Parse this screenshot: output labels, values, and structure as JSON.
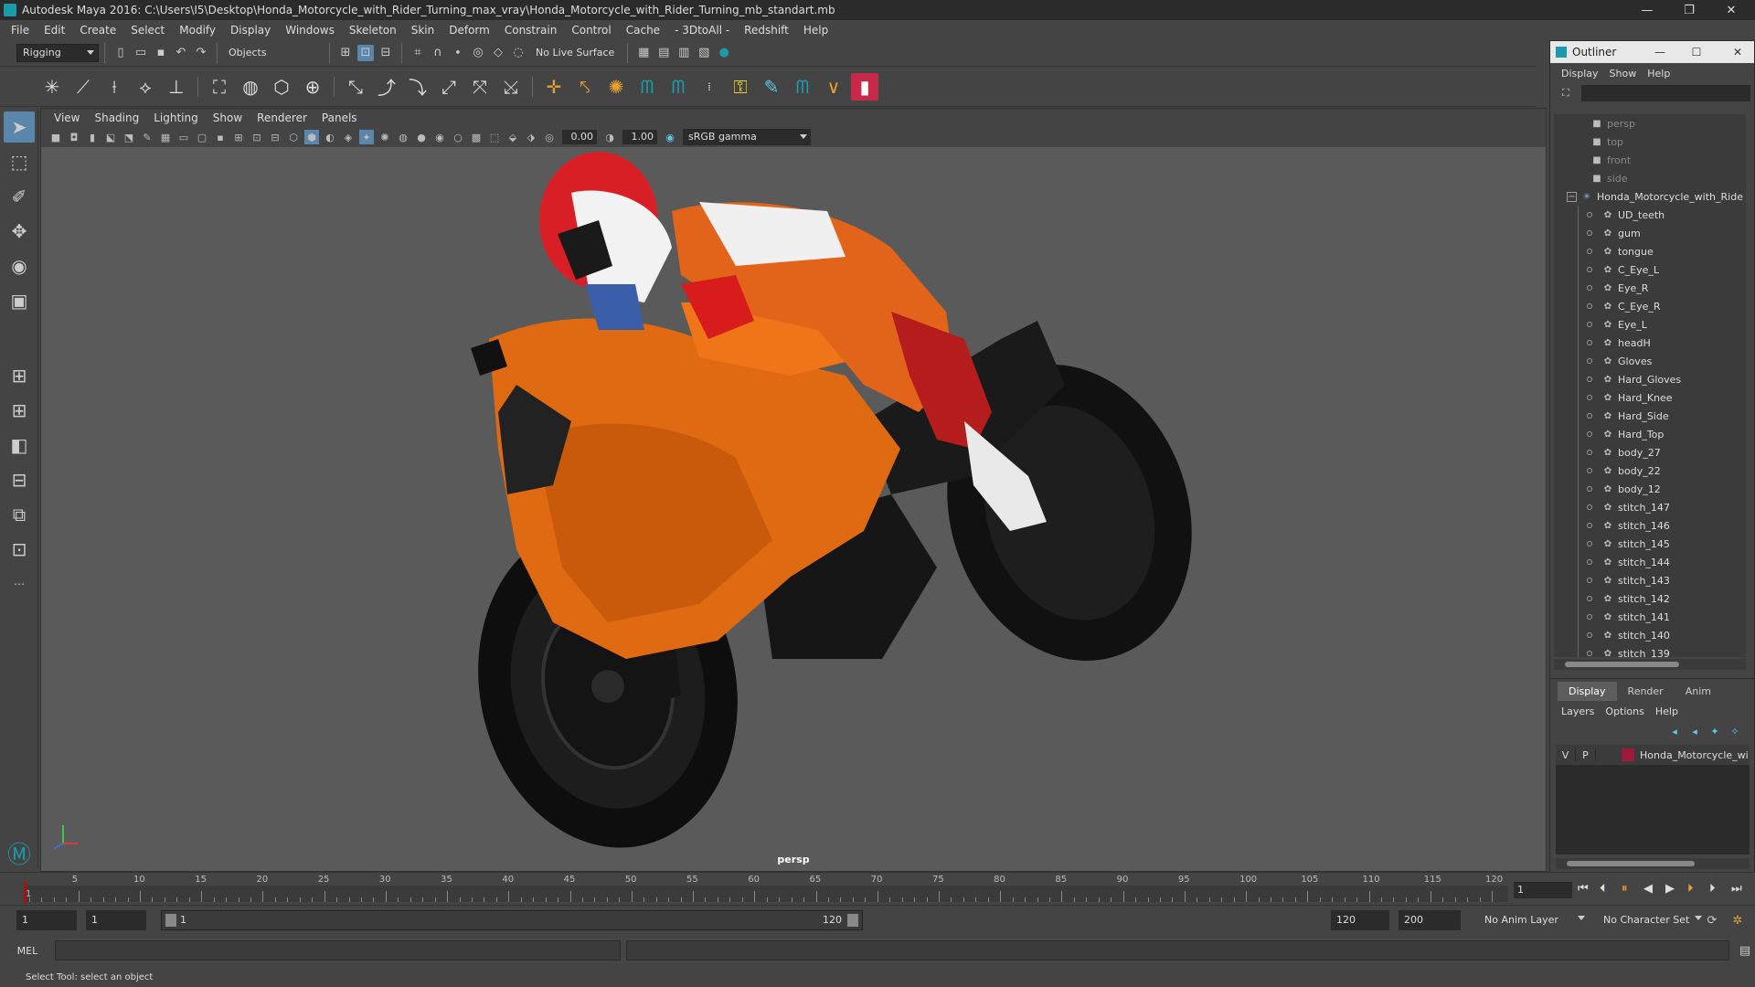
{
  "window": {
    "title": "Autodesk Maya 2016: C:\\Users\\I5\\Desktop\\Honda_Motorcycle_with_Rider_Turning_max_vray\\Honda_Motorcycle_with_Rider_Turning_mb_standart.mb",
    "minimize": "—",
    "maximize": "❐",
    "close": "✕"
  },
  "menu": [
    "File",
    "Edit",
    "Create",
    "Select",
    "Modify",
    "Display",
    "Windows",
    "Skeleton",
    "Skin",
    "Deform",
    "Constrain",
    "Control",
    "Cache",
    "- 3DtoAll -",
    "Redshift",
    "Help"
  ],
  "status_line": {
    "mode": "Rigging",
    "selection_mask": "Objects",
    "live_surface": "No Live Surface"
  },
  "viewport": {
    "menu": [
      "View",
      "Shading",
      "Lighting",
      "Show",
      "Renderer",
      "Panels"
    ],
    "exposure": "0.00",
    "gamma": "1.00",
    "color_space": "sRGB gamma",
    "camera_label": "persp"
  },
  "outliner": {
    "title": "Outliner",
    "menu": [
      "Display",
      "Show",
      "Help"
    ],
    "items": [
      {
        "label": "persp",
        "kind": "camera",
        "dim": true
      },
      {
        "label": "top",
        "kind": "camera",
        "dim": true
      },
      {
        "label": "front",
        "kind": "camera",
        "dim": true
      },
      {
        "label": "side",
        "kind": "camera",
        "dim": true
      },
      {
        "label": "Honda_Motorcycle_with_Ride",
        "kind": "group",
        "dim": false
      },
      {
        "label": "UD_teeth",
        "kind": "mesh",
        "dim": false
      },
      {
        "label": "gum",
        "kind": "mesh",
        "dim": false
      },
      {
        "label": "tongue",
        "kind": "mesh",
        "dim": false
      },
      {
        "label": "C_Eye_L",
        "kind": "mesh",
        "dim": false
      },
      {
        "label": "Eye_R",
        "kind": "mesh",
        "dim": false
      },
      {
        "label": "C_Eye_R",
        "kind": "mesh",
        "dim": false
      },
      {
        "label": "Eye_L",
        "kind": "mesh",
        "dim": false
      },
      {
        "label": "headH",
        "kind": "mesh",
        "dim": false
      },
      {
        "label": "Gloves",
        "kind": "mesh",
        "dim": false
      },
      {
        "label": "Hard_Gloves",
        "kind": "mesh",
        "dim": false
      },
      {
        "label": "Hard_Knee",
        "kind": "mesh",
        "dim": false
      },
      {
        "label": "Hard_Side",
        "kind": "mesh",
        "dim": false
      },
      {
        "label": "Hard_Top",
        "kind": "mesh",
        "dim": false
      },
      {
        "label": "body_27",
        "kind": "mesh",
        "dim": false
      },
      {
        "label": "body_22",
        "kind": "mesh",
        "dim": false
      },
      {
        "label": "body_12",
        "kind": "mesh",
        "dim": false
      },
      {
        "label": "stitch_147",
        "kind": "mesh",
        "dim": false
      },
      {
        "label": "stitch_146",
        "kind": "mesh",
        "dim": false
      },
      {
        "label": "stitch_145",
        "kind": "mesh",
        "dim": false
      },
      {
        "label": "stitch_144",
        "kind": "mesh",
        "dim": false
      },
      {
        "label": "stitch_143",
        "kind": "mesh",
        "dim": false
      },
      {
        "label": "stitch_142",
        "kind": "mesh",
        "dim": false
      },
      {
        "label": "stitch_141",
        "kind": "mesh",
        "dim": false
      },
      {
        "label": "stitch_140",
        "kind": "mesh",
        "dim": false
      },
      {
        "label": "stitch_139",
        "kind": "mesh",
        "dim": false
      }
    ]
  },
  "layers": {
    "tabs": [
      "Display",
      "Render",
      "Anim"
    ],
    "selected_tab": "Display",
    "menu": [
      "Layers",
      "Options",
      "Help"
    ],
    "rows": [
      {
        "v": "V",
        "p": "P",
        "name": "Honda_Motorcycle_wi",
        "color": "#a0183a"
      }
    ]
  },
  "timeline": {
    "ticks": [
      "5",
      "10",
      "15",
      "20",
      "25",
      "30",
      "35",
      "40",
      "45",
      "50",
      "55",
      "60",
      "65",
      "70",
      "75",
      "80",
      "85",
      "90",
      "95",
      "100",
      "105",
      "110",
      "115",
      "120"
    ],
    "ruler_max": 120,
    "start_label": "1",
    "current_frame": "1"
  },
  "range": {
    "start": "1",
    "playback_start": "1",
    "slider_start": "1",
    "slider_end": "120",
    "playback_end": "120",
    "end": "200",
    "anim_layer": "No Anim Layer",
    "character_set": "No Character Set"
  },
  "command_line": {
    "label": "MEL"
  },
  "help_line": "Select Tool: select an object"
}
